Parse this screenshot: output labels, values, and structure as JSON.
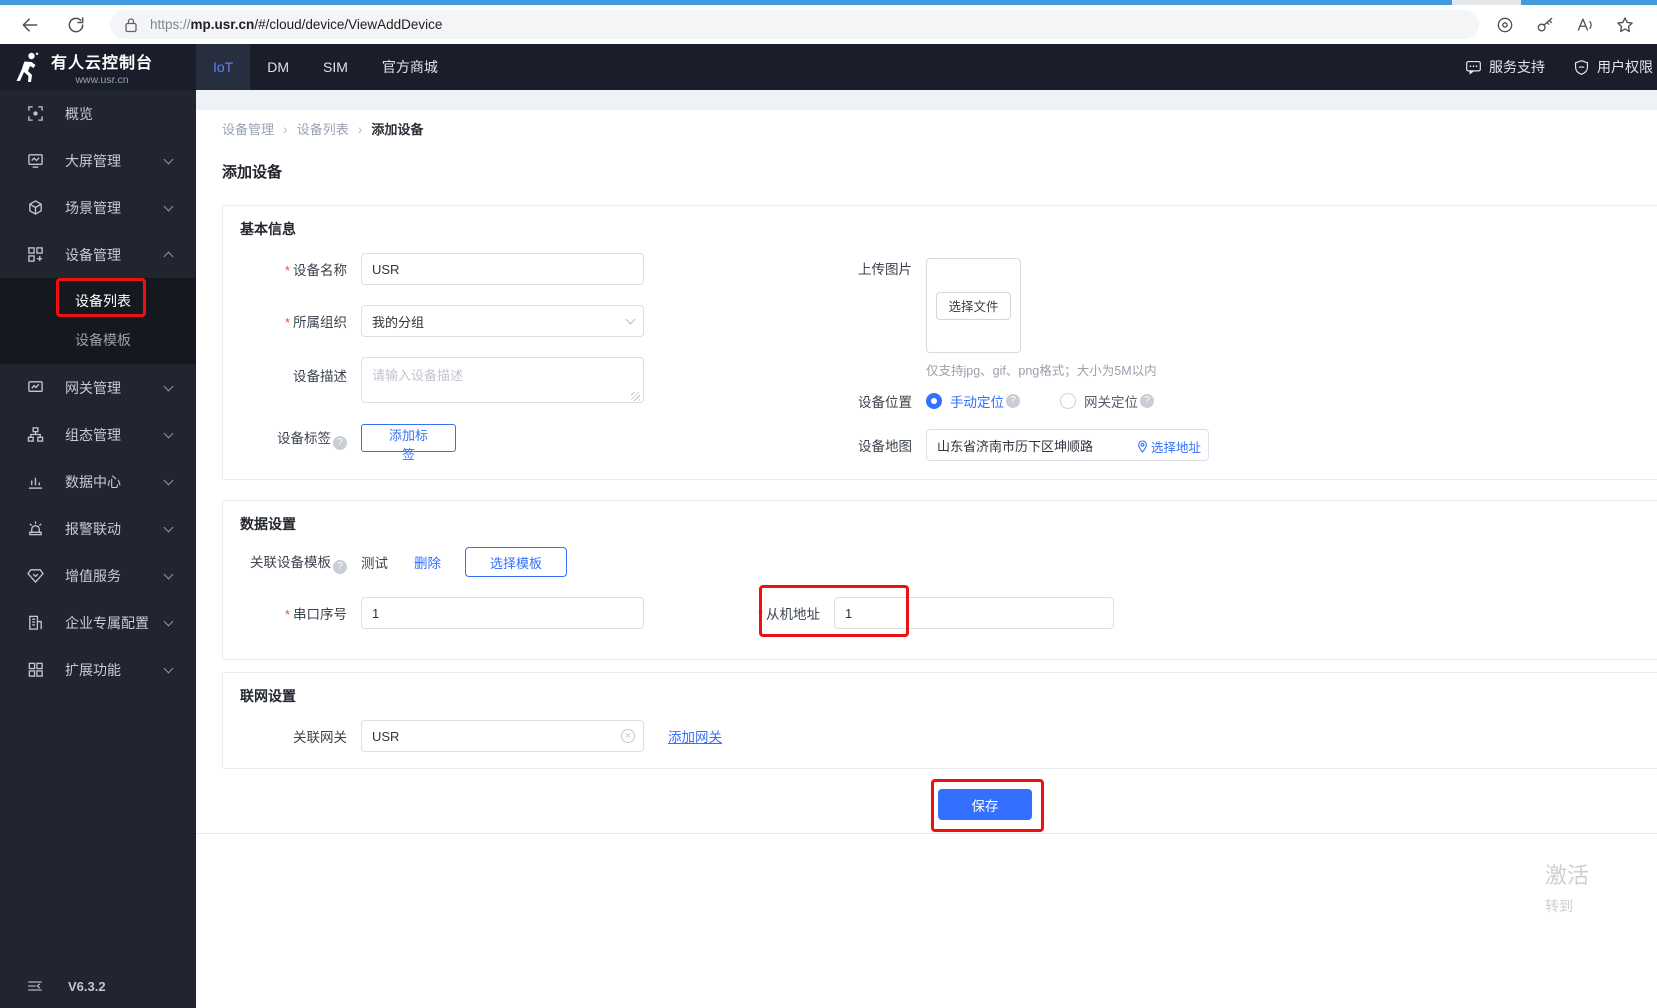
{
  "colors": {
    "accent": "#3370ff",
    "annotation_red": "#ee1010",
    "nav_bg": "#191e2a",
    "sidebar_bg": "#21252f"
  },
  "browser": {
    "url_prefix": "https://",
    "url_host": "mp.usr.cn",
    "url_path": "/#/cloud/device/ViewAddDevice"
  },
  "topnav": {
    "logo_title": "有人云控制台",
    "logo_subtitle": "www.usr.cn",
    "tabs": [
      {
        "label": "IoT"
      },
      {
        "label": "DM"
      },
      {
        "label": "SIM"
      },
      {
        "label": "官方商城"
      }
    ],
    "right": [
      {
        "label": "服务支持"
      },
      {
        "label": "用户权限"
      }
    ]
  },
  "sidebar": {
    "items": [
      {
        "label": "概览"
      },
      {
        "label": "大屏管理"
      },
      {
        "label": "场景管理"
      },
      {
        "label": "设备管理"
      },
      {
        "label": "网关管理"
      },
      {
        "label": "组态管理"
      },
      {
        "label": "数据中心"
      },
      {
        "label": "报警联动"
      },
      {
        "label": "增值服务"
      },
      {
        "label": "企业专属配置"
      },
      {
        "label": "扩展功能"
      }
    ],
    "submenu": [
      {
        "label": "设备列表"
      },
      {
        "label": "设备模板"
      }
    ],
    "version": "V6.3.2"
  },
  "breadcrumb": {
    "separator": "›",
    "items": [
      "设备管理",
      "设备列表",
      "添加设备"
    ]
  },
  "page_title": "添加设备",
  "required_mark": "*",
  "form": {
    "basic": {
      "title": "基本信息",
      "device_name": {
        "label": "设备名称",
        "value": "USR"
      },
      "organization": {
        "label": "所属组织",
        "value": "我的分组"
      },
      "description": {
        "label": "设备描述",
        "placeholder": "请输入设备描述"
      },
      "tags": {
        "label": "设备标签",
        "button": "添加标签"
      },
      "upload": {
        "label": "上传图片",
        "button": "选择文件",
        "hint": "仅支持jpg、gif、png格式；大小为5M以内"
      },
      "location": {
        "label": "设备位置",
        "manual": "手动定位",
        "gateway": "网关定位"
      },
      "map": {
        "label": "设备地图",
        "value": "山东省济南市历下区坤顺路",
        "link": "选择地址"
      }
    },
    "data": {
      "title": "数据设置",
      "template": {
        "label": "关联设备模板",
        "value": "测试",
        "delete_link": "删除",
        "choose_button": "选择模板"
      },
      "serial": {
        "label": "串口序号",
        "value": "1"
      },
      "slave": {
        "label": "从机地址",
        "value": "1"
      }
    },
    "network": {
      "title": "联网设置",
      "gateway": {
        "label": "关联网关",
        "value": "USR",
        "add_link": "添加网关"
      }
    },
    "save_button": "保存"
  },
  "watermark": {
    "line1": "激活",
    "line2": "转到"
  }
}
